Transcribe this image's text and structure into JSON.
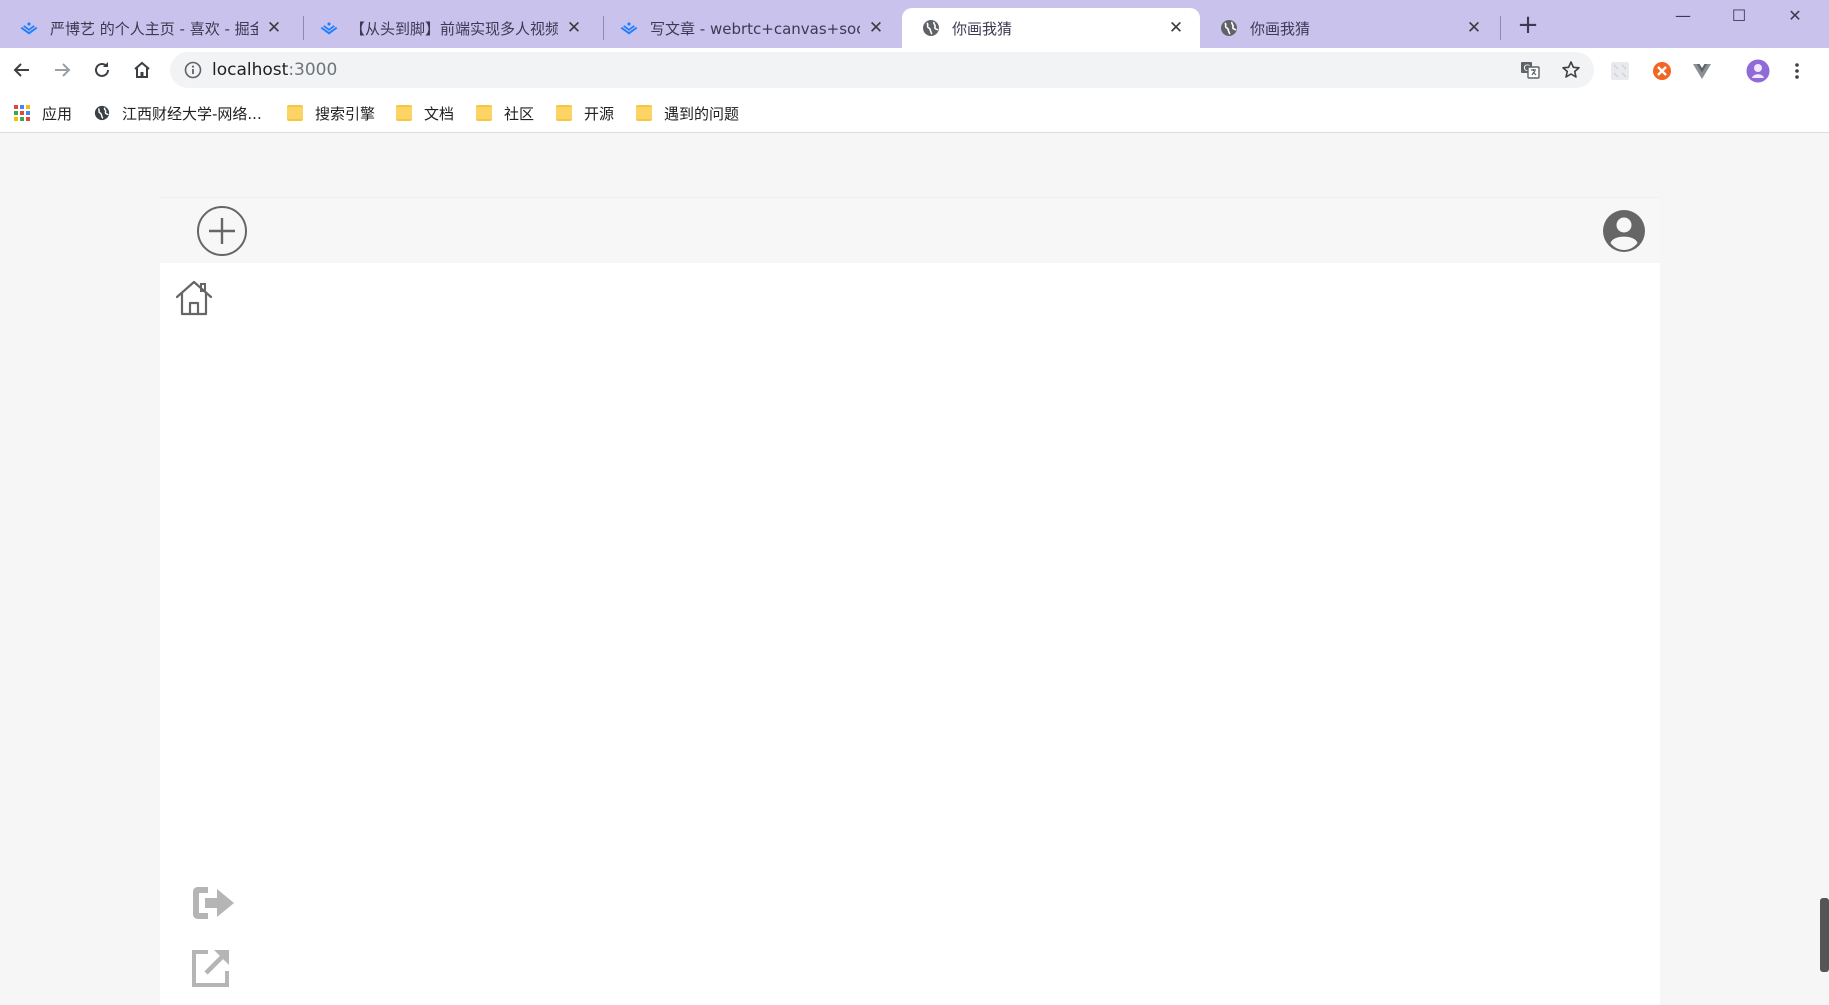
{
  "browser": {
    "tabs": [
      {
        "title": "严博艺 的个人主页 - 喜欢 - 掘金",
        "icon": "juejin-icon",
        "active": false
      },
      {
        "title": "【从头到脚】前端实现多人视频聊",
        "icon": "juejin-icon",
        "active": false
      },
      {
        "title": "写文章 - webrtc+canvas+socke",
        "icon": "juejin-icon",
        "active": false
      },
      {
        "title": "你画我猜",
        "icon": "globe-icon",
        "active": true
      },
      {
        "title": "你画我猜",
        "icon": "globe-icon",
        "active": false
      }
    ],
    "close_glyph": "✕",
    "new_tab_glyph": "+",
    "window_controls": {
      "minimize": "—",
      "maximize": "☐",
      "close": "✕"
    },
    "address": {
      "host": "localhost",
      "port": ":3000"
    },
    "bookmarks": [
      {
        "label": "应用",
        "icon": "apps-grid-icon"
      },
      {
        "label": "江西财经大学-网络...",
        "icon": "globe-icon"
      },
      {
        "label": "搜索引擎",
        "icon": "folder-icon"
      },
      {
        "label": "文档",
        "icon": "folder-icon"
      },
      {
        "label": "社区",
        "icon": "folder-icon"
      },
      {
        "label": "开源",
        "icon": "folder-icon"
      },
      {
        "label": "遇到的问题",
        "icon": "folder-icon"
      }
    ],
    "colors": {
      "tabstrip": "#c8c2ec",
      "juejin_blue": "#1e80ff",
      "folder": "#f5c642"
    }
  },
  "app": {
    "header": {
      "add_icon": "plus-circle-icon",
      "user_icon": "user-circle-icon"
    },
    "nav": {
      "home_icon": "home-icon"
    },
    "bottom_actions": {
      "exit_icon": "sign-out-icon",
      "share_icon": "external-link-icon"
    },
    "colors": {
      "icon_gray": "#666666",
      "icon_light_gray": "#b5b5b5"
    }
  }
}
